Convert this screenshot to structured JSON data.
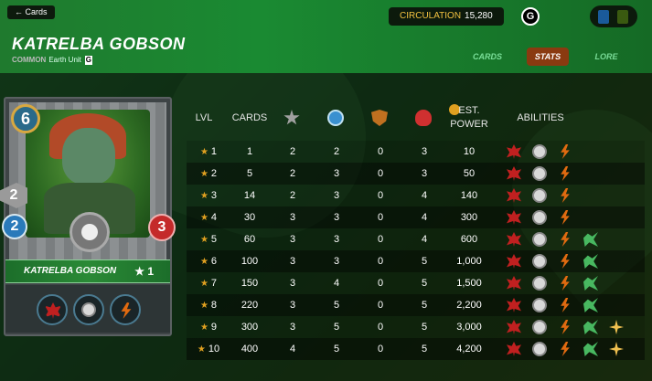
{
  "header": {
    "back_label": "← Cards",
    "title": "KATRELBA GOBSON",
    "rarity": "COMMON",
    "type_label": "Earth Unit",
    "circulation_label": "CIRCULATION",
    "circulation_value": "15,280",
    "g_badge": "G",
    "tabs": [
      {
        "label": "CARDS",
        "active": false
      },
      {
        "label": "STATS",
        "active": true
      },
      {
        "label": "LORE",
        "active": false
      }
    ]
  },
  "card": {
    "mana": "6",
    "melee": "2",
    "speed": "2",
    "health": "3",
    "name": "KATRELBA GOBSON",
    "level": "★ 1",
    "abilities": [
      "fury-icon",
      "helm-icon",
      "bolt-icon"
    ]
  },
  "table": {
    "headers": {
      "lvl": "LVL",
      "cards": "CARDS",
      "est_power": "EST. POWER",
      "abilities": "ABILITIES"
    },
    "header_icons": [
      "melee-icon",
      "speed-icon",
      "armor-icon",
      "health-icon",
      "info-icon"
    ],
    "rows": [
      {
        "lvl": "1",
        "cards": "1",
        "melee": "2",
        "speed": "2",
        "armor": "0",
        "health": "3",
        "power": "10",
        "abilities": [
          "fury",
          "helm",
          "bolt"
        ]
      },
      {
        "lvl": "2",
        "cards": "5",
        "melee": "2",
        "speed": "3",
        "armor": "0",
        "health": "3",
        "power": "50",
        "abilities": [
          "fury",
          "helm",
          "bolt"
        ]
      },
      {
        "lvl": "3",
        "cards": "14",
        "melee": "2",
        "speed": "3",
        "armor": "0",
        "health": "4",
        "power": "140",
        "abilities": [
          "fury",
          "helm",
          "bolt"
        ]
      },
      {
        "lvl": "4",
        "cards": "30",
        "melee": "3",
        "speed": "3",
        "armor": "0",
        "health": "4",
        "power": "300",
        "abilities": [
          "fury",
          "helm",
          "bolt"
        ]
      },
      {
        "lvl": "5",
        "cards": "60",
        "melee": "3",
        "speed": "3",
        "armor": "0",
        "health": "4",
        "power": "600",
        "abilities": [
          "fury",
          "helm",
          "bolt",
          "hoof"
        ]
      },
      {
        "lvl": "6",
        "cards": "100",
        "melee": "3",
        "speed": "3",
        "armor": "0",
        "health": "5",
        "power": "1,000",
        "abilities": [
          "fury",
          "helm",
          "bolt",
          "hoof"
        ]
      },
      {
        "lvl": "7",
        "cards": "150",
        "melee": "3",
        "speed": "4",
        "armor": "0",
        "health": "5",
        "power": "1,500",
        "abilities": [
          "fury",
          "helm",
          "bolt",
          "hoof"
        ]
      },
      {
        "lvl": "8",
        "cards": "220",
        "melee": "3",
        "speed": "5",
        "armor": "0",
        "health": "5",
        "power": "2,200",
        "abilities": [
          "fury",
          "helm",
          "bolt",
          "hoof"
        ]
      },
      {
        "lvl": "9",
        "cards": "300",
        "melee": "3",
        "speed": "5",
        "armor": "0",
        "health": "5",
        "power": "3,000",
        "abilities": [
          "fury",
          "helm",
          "bolt",
          "hoof",
          "spark"
        ]
      },
      {
        "lvl": "10",
        "cards": "400",
        "melee": "4",
        "speed": "5",
        "armor": "0",
        "health": "5",
        "power": "4,200",
        "abilities": [
          "fury",
          "helm",
          "bolt",
          "hoof",
          "spark"
        ]
      }
    ]
  }
}
